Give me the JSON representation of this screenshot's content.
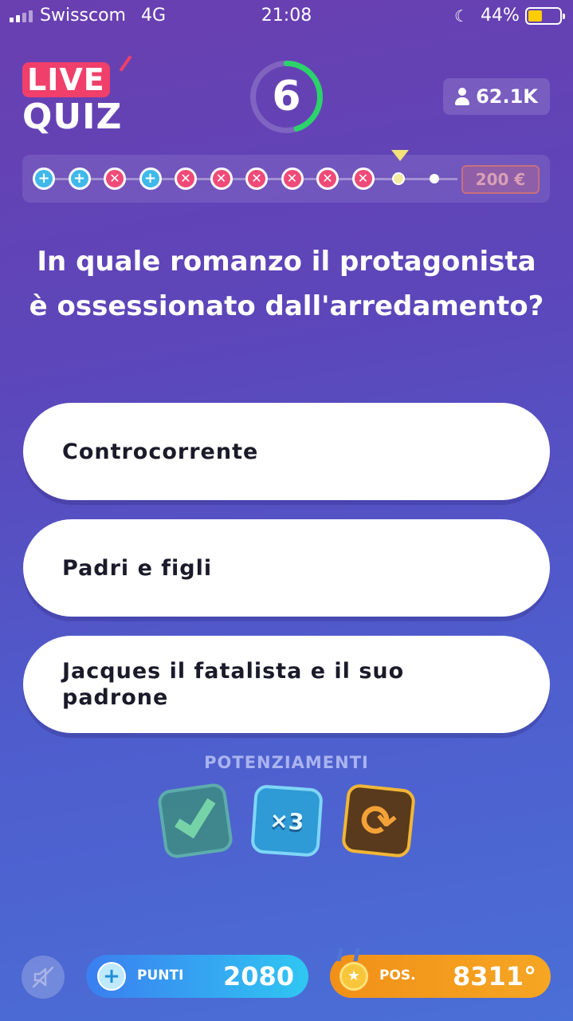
{
  "status_bar": {
    "carrier": "Swisscom",
    "network": "4G",
    "time": "21:08",
    "battery": "44%",
    "battery_level": 0.44
  },
  "header": {
    "logo_top": "LIVE",
    "logo_bottom": "QUIZ",
    "timer": "6",
    "timer_progress": 0.45,
    "viewers": "62.1K"
  },
  "progress": {
    "steps": [
      "plus",
      "plus",
      "wrong",
      "plus",
      "wrong",
      "wrong",
      "wrong",
      "wrong",
      "wrong",
      "wrong",
      "current",
      "pending"
    ],
    "prize": "200 €"
  },
  "question": "In quale romanzo il protagonista è ossessionato dall'arredamento?",
  "answers": [
    "Controcorrente",
    "Padri e figli",
    "Jacques il fatalista e il suo padrone"
  ],
  "powerups": {
    "title": "POTENZIAMENTI",
    "items": [
      "check",
      "plus-three",
      "swap"
    ]
  },
  "bottom": {
    "points_label": "PUNTI",
    "points_value": "2080",
    "pos_label": "POS.",
    "pos_value": "8311°"
  },
  "colors": {
    "wrong": "#ef4a78",
    "plus": "#3fb8ea",
    "timer_ring": "#2bd36a"
  }
}
